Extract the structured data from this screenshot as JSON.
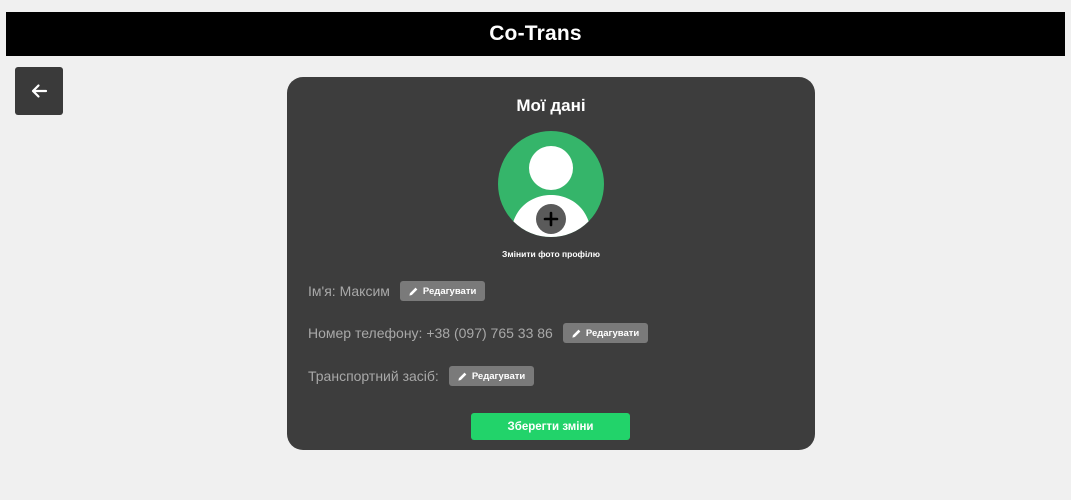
{
  "header": {
    "title": "Co-Trans"
  },
  "back_button": {
    "icon": "arrow-left-icon"
  },
  "profile": {
    "title": "Мої дані",
    "avatar": {
      "icon": "user-avatar-icon",
      "add_icon": "plus-icon",
      "bg_color": "#35b56a"
    },
    "change_photo_label": "Змінити фото профілю",
    "fields": [
      {
        "label": "Ім'я:",
        "value": "Максим",
        "edit_label": "Редагувати"
      },
      {
        "label": "Номер телефону:",
        "value": "+38 (097) 765 33 86",
        "edit_label": "Редагувати"
      },
      {
        "label": "Транспортний засіб:",
        "value": "",
        "edit_label": "Редагувати"
      }
    ],
    "save_label": "Зберегти зміни",
    "save_color": "#22d36a"
  }
}
